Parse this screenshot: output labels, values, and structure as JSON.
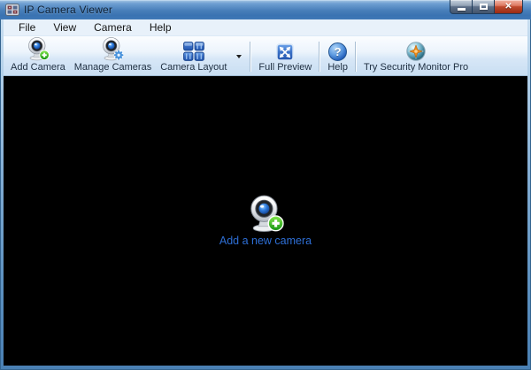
{
  "window": {
    "title": "IP Camera Viewer"
  },
  "menu_bar": {
    "items": [
      {
        "label": "File"
      },
      {
        "label": "View"
      },
      {
        "label": "Camera"
      },
      {
        "label": "Help"
      }
    ]
  },
  "toolbar": {
    "add_camera_label": "Add Camera",
    "manage_cameras_label": "Manage Cameras",
    "camera_layout_label": "Camera Layout",
    "full_preview_label": "Full Preview",
    "help_label": "Help",
    "try_pro_label": "Try Security Monitor Pro"
  },
  "viewer": {
    "empty_state_label": "Add a new camera"
  },
  "icons": {
    "titlebar": "app-grid-icon",
    "add_camera": "webcam-plus-icon",
    "manage_cameras": "webcam-gear-icon",
    "camera_layout": "grid-layout-icon",
    "full_preview": "expand-arrows-icon",
    "help": "question-mark-icon",
    "try_pro": "compass-star-icon",
    "empty_state": "webcam-plus-icon"
  },
  "colors": {
    "titlebar_blue": "#3f78b6",
    "toolbar_light_blue": "#e3effa",
    "viewer_background": "#000000",
    "link_blue": "#2e6fd6",
    "badge_green": "#1fa81f",
    "icon_blue": "#2f6fd0",
    "close_button_red": "#bf4a2e"
  }
}
